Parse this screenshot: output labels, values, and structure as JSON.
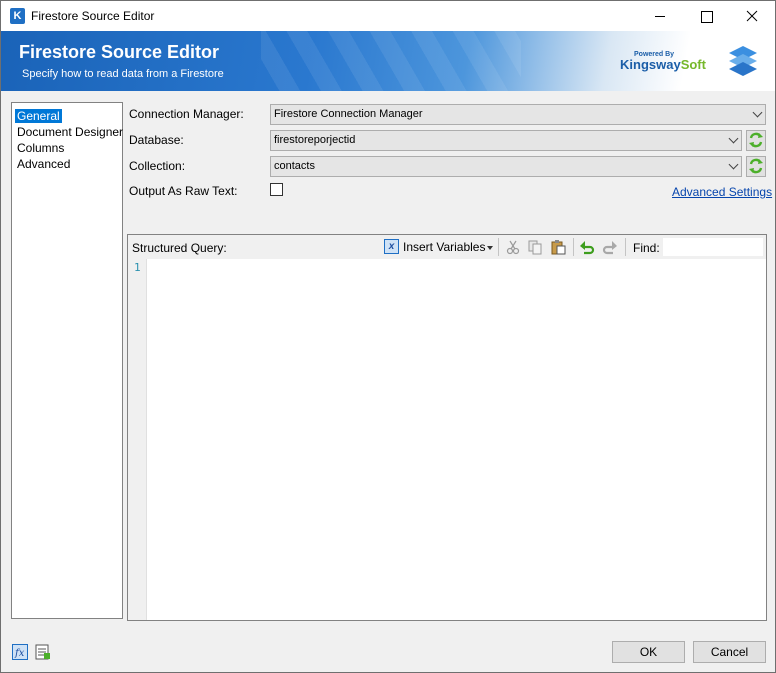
{
  "window": {
    "title": "Firestore Source Editor",
    "icon_name": "kingswaysoft-k-icon"
  },
  "banner": {
    "title": "Firestore Source Editor",
    "subtitle": "Specify how to read data from a Firestore",
    "brand_powered": "Powered By",
    "brand_name_a": "Kingsway",
    "brand_name_b": "Soft"
  },
  "nav": {
    "items": [
      {
        "label": "General",
        "selected": true
      },
      {
        "label": "Document Designer",
        "selected": false
      },
      {
        "label": "Columns",
        "selected": false
      },
      {
        "label": "Advanced",
        "selected": false
      }
    ]
  },
  "form": {
    "connection_label": "Connection Manager:",
    "connection_value": "Firestore Connection Manager",
    "database_label": "Database:",
    "database_value": "firestoreporjectid",
    "collection_label": "Collection:",
    "collection_value": "contacts",
    "raw_text_label": "Output As Raw Text:",
    "raw_text_checked": false,
    "advanced_link": "Advanced Settings"
  },
  "query": {
    "label": "Structured Query:",
    "insert_variables": "Insert Variables",
    "find_label": "Find:",
    "find_value": "",
    "line_numbers": [
      "1"
    ],
    "content": ""
  },
  "footer": {
    "ok_label": "OK",
    "cancel_label": "Cancel"
  },
  "colors": {
    "accent": "#0078d7",
    "banner": "#1a63b8",
    "link": "#0645ad",
    "refresh_green": "#4caf2a"
  }
}
